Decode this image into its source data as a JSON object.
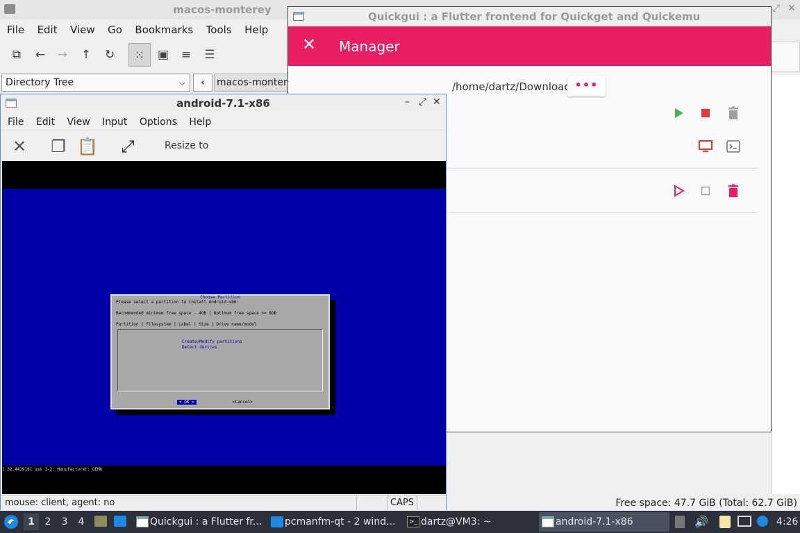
{
  "fm": {
    "title": "macos-monterey",
    "menu": [
      "File",
      "Edit",
      "View",
      "Go",
      "Bookmarks",
      "Tools",
      "Help"
    ],
    "sidebar_select": "Directory Tree",
    "path_tab": "macos-monterey",
    "status": "Free space: 47.7 GiB (Total: 62.7 GiB)"
  },
  "qg": {
    "title": "Quickgui : a Flutter frontend for Quickget and Quickemu",
    "header": "Manager",
    "downloads_path": "/home/dartz/Downloads",
    "more_label": "•••",
    "colors": {
      "accent": "#e91e63",
      "play_green": "#4caf50",
      "stop_red": "#e53935"
    }
  },
  "aw": {
    "title": "android-7.1-x86",
    "menu": [
      "File",
      "Edit",
      "View",
      "Input",
      "Options",
      "Help"
    ],
    "resize_label": "Resize to",
    "status_mouse": "mouse: client, agent:  no",
    "status_caps": "CAPS",
    "dialog": {
      "title": "Choose Partition",
      "line1": "Please select a partition to install Android-x86:",
      "line2": "Recommended minimum free space - 4GB  |  Optimum free space >= 8GB",
      "line3": "Partition | Filesystem | Label          | Size     | Drive name/model",
      "opt1": "Create/Modify partitions",
      "opt2": "Detect devices",
      "ok": "<  OK  >",
      "cancel": "<Cancel>"
    },
    "vm_bottom_text": "[   32.4429181 usb 1-2: Manufacturer: QEMU"
  },
  "taskbar": {
    "workspaces": [
      "1",
      "2",
      "3",
      "4"
    ],
    "tasks": [
      {
        "label": "Quickgui : a Flutter fr...",
        "icon": "window-icon"
      },
      {
        "label": "pcmanfm-qt - 2 wind...",
        "icon": "folder-icon"
      },
      {
        "label": "dartz@VM3: ~",
        "icon": "terminal-icon"
      },
      {
        "label": "android-7.1-x86",
        "icon": "window-icon"
      }
    ],
    "clock": "4:26"
  }
}
